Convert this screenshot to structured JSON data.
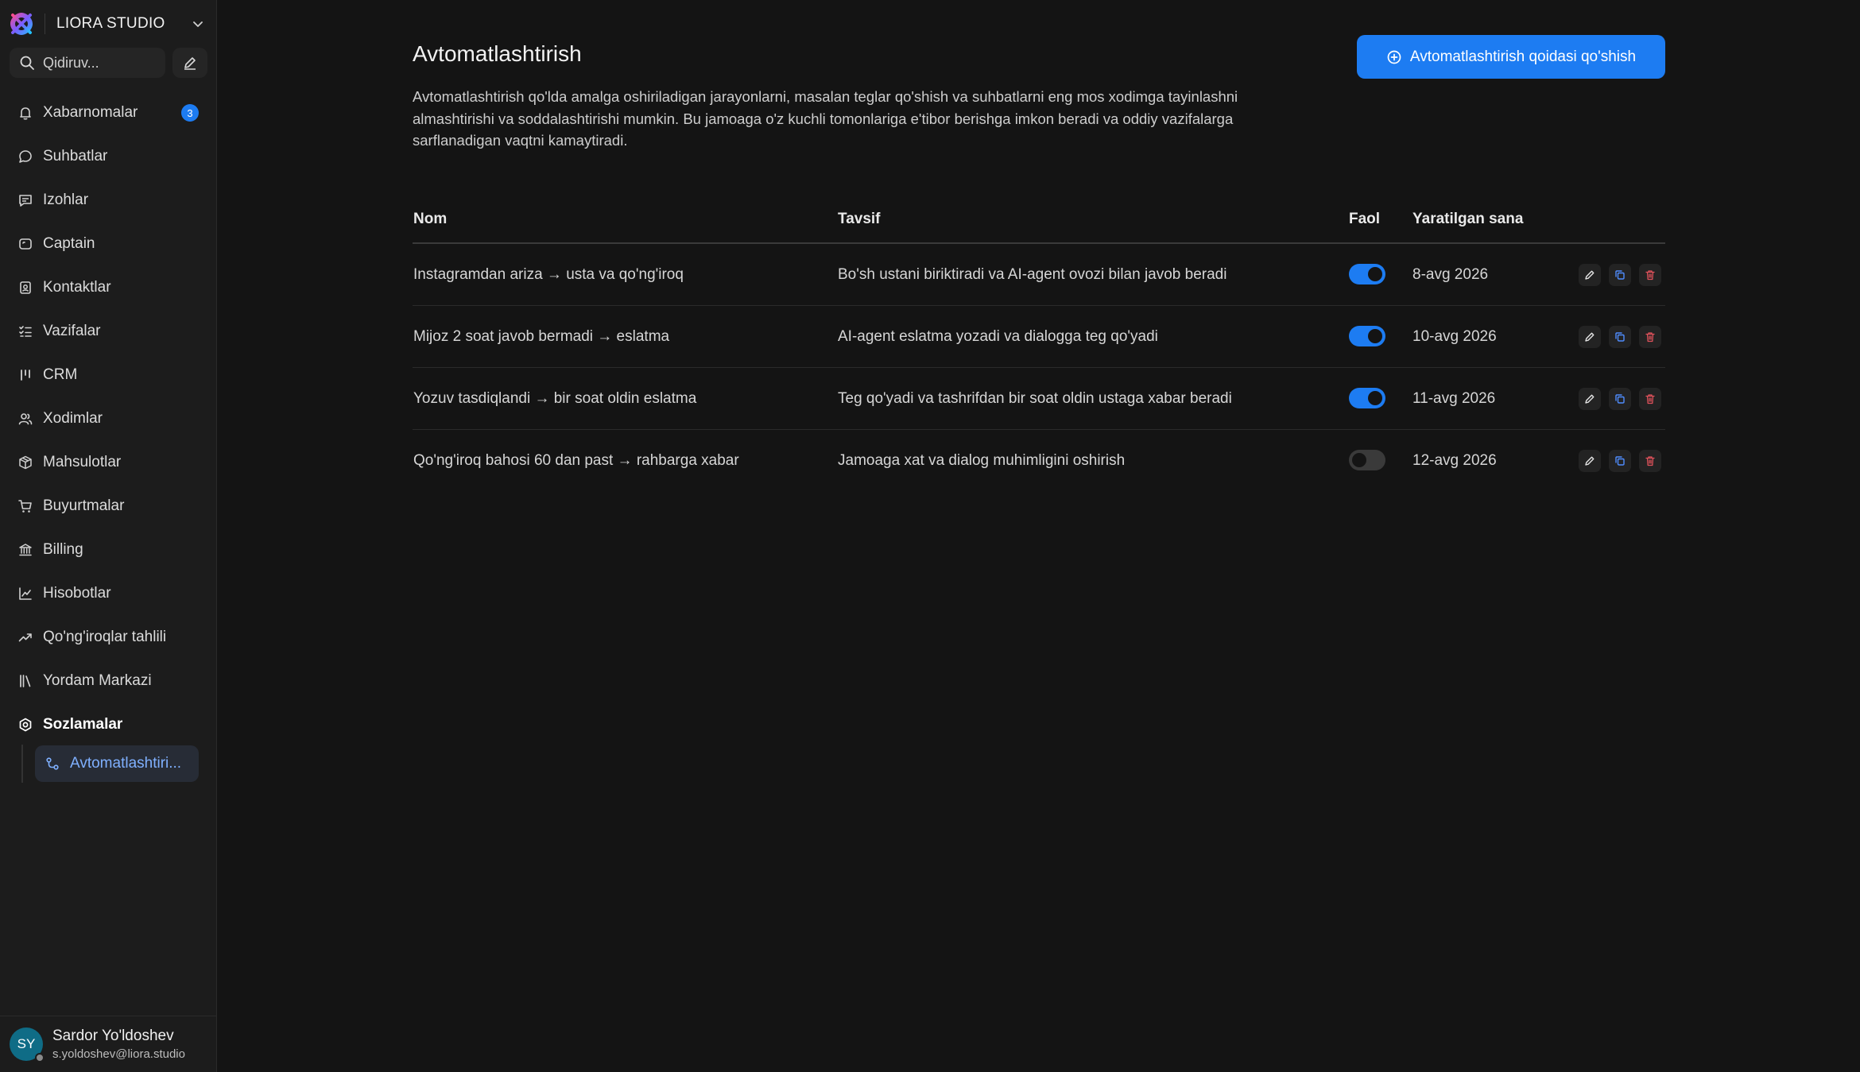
{
  "brand": {
    "name": "LIORA STUDIO"
  },
  "search": {
    "placeholder": "Qidiruv..."
  },
  "sidebar": {
    "items": [
      {
        "label": "Xabarnomalar",
        "icon": "bell-icon",
        "badge": "3"
      },
      {
        "label": "Suhbatlar",
        "icon": "chat-bubble-icon"
      },
      {
        "label": "Izohlar",
        "icon": "comment-icon"
      },
      {
        "label": "Captain",
        "icon": "captain-icon"
      },
      {
        "label": "Kontaktlar",
        "icon": "contact-card-icon"
      },
      {
        "label": "Vazifalar",
        "icon": "checklist-icon"
      },
      {
        "label": "CRM",
        "icon": "crm-bars-icon"
      },
      {
        "label": "Xodimlar",
        "icon": "users-icon"
      },
      {
        "label": "Mahsulotlar",
        "icon": "box-icon"
      },
      {
        "label": "Buyurtmalar",
        "icon": "cart-icon"
      },
      {
        "label": "Billing",
        "icon": "bank-icon"
      },
      {
        "label": "Hisobotlar",
        "icon": "line-chart-icon"
      },
      {
        "label": "Qo'ng'iroqlar tahlili",
        "icon": "trending-up-icon"
      },
      {
        "label": "Yordam Markazi",
        "icon": "library-icon"
      },
      {
        "label": "Sozlamalar",
        "icon": "settings-icon",
        "active": true
      }
    ],
    "sub_item": {
      "label": "Avtomatlashtiri...",
      "icon": "automation-icon"
    }
  },
  "user": {
    "initials": "SY",
    "name": "Sardor Yo'ldoshev",
    "email": "s.yoldoshev@liora.studio"
  },
  "page": {
    "title": "Avtomatlashtirish",
    "add_button": "Avtomatlashtirish qoidasi qo'shish",
    "description": "Avtomatlashtirish qo'lda amalga oshiriladigan jarayonlarni, masalan teglar qo'shish va suhbatlarni eng mos xodimga tayinlashni almashtirishi va soddalashtirishi mumkin. Bu jamoaga o'z kuchli tomonlariga e'tibor berishga imkon beradi va oddiy vazifalarga sarflanadigan vaqtni kamaytiradi."
  },
  "table": {
    "headers": {
      "name": "Nom",
      "description": "Tavsif",
      "active": "Faol",
      "created": "Yaratilgan sana"
    },
    "rows": [
      {
        "name": "Instagramdan ariza → usta va qo'ng'iroq",
        "description": "Bo'sh ustani biriktiradi va AI-agent ovozi bilan javob beradi",
        "active": true,
        "created": "8-avg 2026"
      },
      {
        "name": "Mijoz 2 soat javob bermadi → eslatma",
        "description": "AI-agent eslatma yozadi va dialogga teg qo'yadi",
        "active": true,
        "created": "10-avg 2026"
      },
      {
        "name": "Yozuv tasdiqlandi → bir soat oldin eslatma",
        "description": "Teg qo'yadi va tashrifdan bir soat oldin ustaga xabar beradi",
        "active": true,
        "created": "11-avg 2026"
      },
      {
        "name": "Qo'ng'iroq bahosi 60 dan past → rahbarga xabar",
        "description": "Jamoaga xat va dialog muhimligini oshirish",
        "active": false,
        "created": "12-avg 2026"
      }
    ]
  },
  "colors": {
    "accent": "#1d7cf2",
    "background": "#141414",
    "sidebar": "#1c1c1c",
    "danger": "#e0525b"
  }
}
